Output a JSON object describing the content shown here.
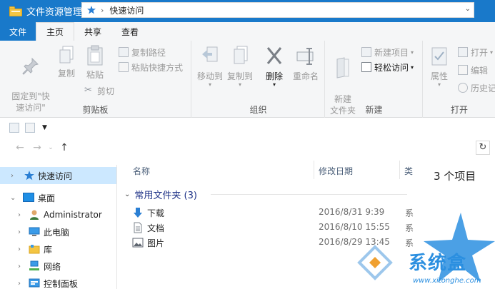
{
  "window": {
    "title": "文件资源管理器"
  },
  "tabs": [
    {
      "label": "文件"
    },
    {
      "label": "主页"
    },
    {
      "label": "共享"
    },
    {
      "label": "查看"
    }
  ],
  "ribbon": {
    "clipboard": {
      "label": "剪贴板",
      "pin": "固定到\"快\n速访问\"",
      "copy": "复制",
      "paste": "粘贴",
      "copy_path": "复制路径",
      "paste_shortcut": "粘贴快捷方式",
      "cut": "剪切"
    },
    "organize": {
      "label": "组织",
      "move_to": "移动到",
      "copy_to": "复制到",
      "delete": "删除",
      "rename": "重命名"
    },
    "new": {
      "label": "新建",
      "new_folder": "新建\n文件夹",
      "new_item": "新建项目",
      "easy_access": "轻松访问"
    },
    "open": {
      "label": "打开",
      "properties": "属性",
      "open": "打开",
      "edit": "编辑",
      "history": "历史记"
    }
  },
  "address": {
    "location": "快速访问"
  },
  "nav_pane": {
    "items": [
      {
        "label": "快速访问",
        "icon": "star-icon",
        "selected": true
      },
      {
        "label": "桌面",
        "icon": "desktop-icon",
        "expanded": true
      },
      {
        "label": "Administrator",
        "icon": "user-icon"
      },
      {
        "label": "此电脑",
        "icon": "computer-icon"
      },
      {
        "label": "库",
        "icon": "library-icon"
      },
      {
        "label": "网络",
        "icon": "network-icon"
      },
      {
        "label": "控制面板",
        "icon": "control-panel-icon"
      }
    ]
  },
  "content": {
    "columns": {
      "name": "名称",
      "date": "修改日期",
      "type": "类"
    },
    "group": "常用文件夹 (3)",
    "rows": [
      {
        "name": "下载",
        "date": "2016/8/31 9:39",
        "type": "系",
        "icon": "download-icon"
      },
      {
        "name": "文档",
        "date": "2016/8/10 15:55",
        "type": "系",
        "icon": "document-icon"
      },
      {
        "name": "图片",
        "date": "2016/8/29 13:45",
        "type": "系",
        "icon": "picture-icon"
      }
    ]
  },
  "status": {
    "count": "3 个项目"
  },
  "watermark": {
    "text": "系统盒",
    "url": "www.xitonghe.com"
  },
  "colors": {
    "titlebar": "#1979ca",
    "selection": "#cce8ff",
    "group_header": "#1e3287"
  }
}
